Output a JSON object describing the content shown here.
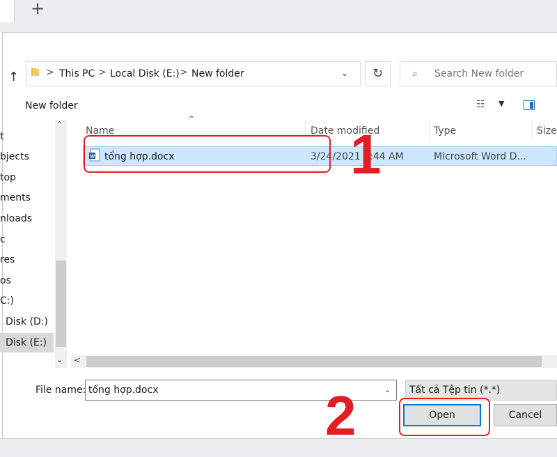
{
  "browser": {
    "new_tab_glyph": "+"
  },
  "address_bar": {
    "up_icon": "up-arrow-icon",
    "breadcrumb": [
      "This PC",
      "Local Disk (E:)",
      "New folder"
    ],
    "separator": ">",
    "dropdown_glyph": "⌄",
    "refresh_glyph": "↻"
  },
  "search": {
    "icon": "search-icon",
    "placeholder": "Search New folder"
  },
  "toolbar": {
    "new_folder_label": "New folder",
    "view_glyph": "☷",
    "view_dropdown_glyph": "▼"
  },
  "nav_pane": {
    "items": [
      "t",
      "bjects",
      "top",
      "ments",
      "nloads",
      "c",
      "res",
      "os",
      "C:)",
      "Disk (D:)",
      "Disk (E:)"
    ],
    "selected": "Disk (E:)"
  },
  "columns": [
    "Name",
    "Date modified",
    "Type",
    "Size"
  ],
  "files": [
    {
      "name": "tổng hợp.docx",
      "date_modified": "3/24/2021 8:44 AM",
      "type": "Microsoft Word D...",
      "icon": "word-document-icon"
    }
  ],
  "file_name": {
    "label": "File name:",
    "value": "tổng hợp.docx"
  },
  "filter": {
    "value": "Tất cả Tệp tin (*.*)"
  },
  "buttons": {
    "open": "Open",
    "cancel": "Cancel"
  },
  "annotations": {
    "step1": "1",
    "step2": "2",
    "color": "#e21d24"
  },
  "colors": {
    "accent": "#0078d7",
    "selection": "#cce8ff"
  }
}
